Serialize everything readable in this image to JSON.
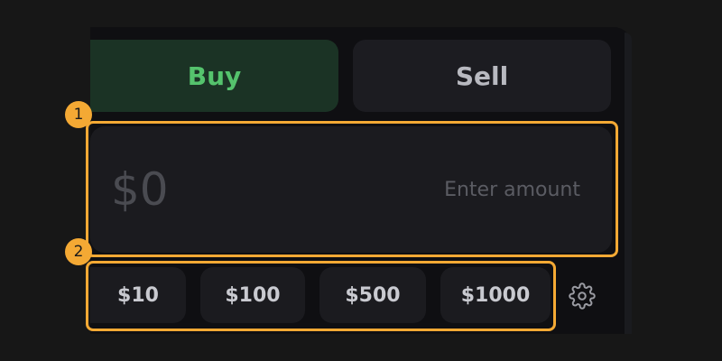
{
  "tabs": {
    "buy_label": "Buy",
    "sell_label": "Sell",
    "active": "Buy"
  },
  "amount": {
    "value": "$0",
    "placeholder": "Enter amount"
  },
  "presets": [
    "$10",
    "$100",
    "$500",
    "$1000"
  ],
  "settings": {
    "icon": "gear-icon"
  },
  "annotations": {
    "marker_1": "1",
    "marker_2": "2"
  },
  "colors": {
    "buy_accent": "#55c36d",
    "buy_bg": "#1b3325",
    "highlight": "#f4a934"
  }
}
